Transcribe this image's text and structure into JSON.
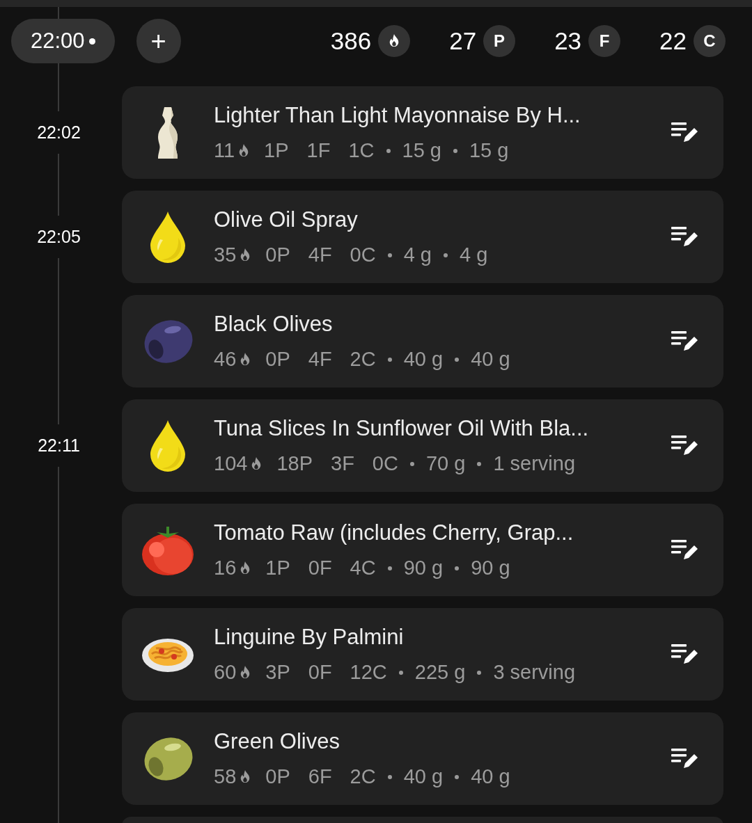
{
  "header": {
    "time": "22:00",
    "add_button": "+",
    "totals": [
      {
        "kind": "calories",
        "value": "386"
      },
      {
        "kind": "macro",
        "value": "27",
        "badge": "P"
      },
      {
        "kind": "macro",
        "value": "23",
        "badge": "F"
      },
      {
        "kind": "macro",
        "value": "22",
        "badge": "C"
      }
    ]
  },
  "entries": [
    {
      "time": "22:02",
      "kind": "bottle",
      "name": "Lighter Than Light Mayonnaise By H...",
      "calories": "11",
      "protein": "1P",
      "fat": "1F",
      "carbs": "1C",
      "weight": "15 g",
      "portion": "15 g"
    },
    {
      "time": "22:05",
      "kind": "drop",
      "name": "Olive Oil Spray",
      "calories": "35",
      "protein": "0P",
      "fat": "4F",
      "carbs": "0C",
      "weight": "4 g",
      "portion": "4 g"
    },
    {
      "kind": "blackolive",
      "name": "Black Olives",
      "calories": "46",
      "protein": "0P",
      "fat": "4F",
      "carbs": "2C",
      "weight": "40 g",
      "portion": "40 g"
    },
    {
      "time": "22:11",
      "kind": "drop",
      "name": "Tuna Slices In Sunflower Oil With Bla...",
      "calories": "104",
      "protein": "18P",
      "fat": "3F",
      "carbs": "0C",
      "weight": "70 g",
      "portion": "1 serving"
    },
    {
      "kind": "tomato",
      "name": "Tomato Raw (includes Cherry, Grap...",
      "calories": "16",
      "protein": "1P",
      "fat": "0F",
      "carbs": "4C",
      "weight": "90 g",
      "portion": "90 g"
    },
    {
      "kind": "pasta",
      "name": "Linguine By Palmini",
      "calories": "60",
      "protein": "3P",
      "fat": "0F",
      "carbs": "12C",
      "weight": "225 g",
      "portion": "3 serving"
    },
    {
      "kind": "greenolive",
      "name": "Green Olives",
      "calories": "58",
      "protein": "0P",
      "fat": "6F",
      "carbs": "2C",
      "weight": "40 g",
      "portion": "40 g"
    }
  ]
}
